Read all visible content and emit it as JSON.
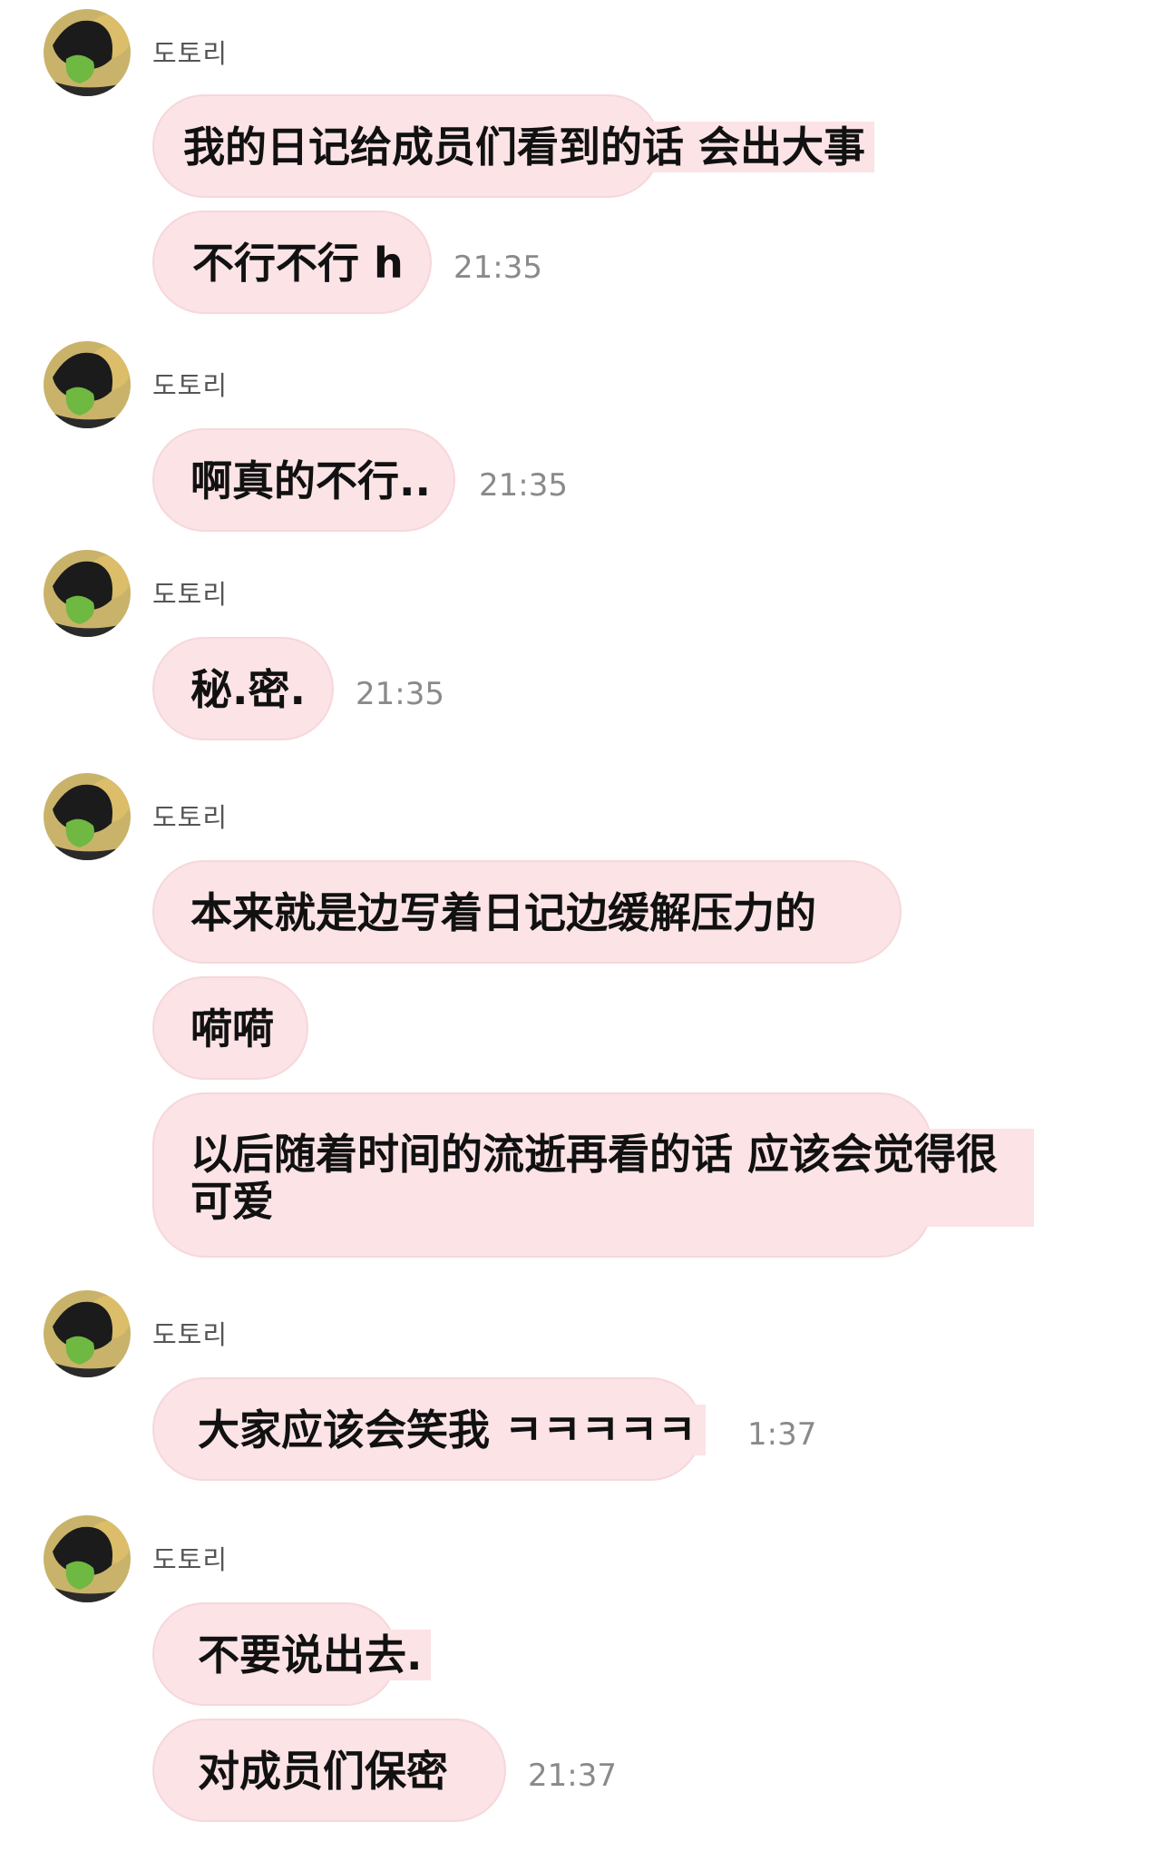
{
  "groups": [
    {
      "sender": "도토리",
      "messages": [
        {
          "text": "我的日记给成员们看到的话 会出大事"
        },
        {
          "text": "不行不行 h",
          "time": "21:35"
        }
      ]
    },
    {
      "sender": "도토리",
      "messages": [
        {
          "text": "啊真的不行..",
          "time": "21:35"
        }
      ]
    },
    {
      "sender": "도토리",
      "messages": [
        {
          "text": "秘.密.",
          "time": "21:35"
        }
      ]
    },
    {
      "sender": "도토리",
      "messages": [
        {
          "text": "本来就是边写着日记边缓解压力的"
        },
        {
          "text": "嗬嗬"
        },
        {
          "text": "以后随着时间的流逝再看的话 应该会觉得很可爱"
        }
      ]
    },
    {
      "sender": "도토리",
      "messages": [
        {
          "text": "大家应该会笑我 ㅋㅋㅋㅋㅋ",
          "time": "1:37"
        }
      ]
    },
    {
      "sender": "도토리",
      "messages": [
        {
          "text": "不要说出去."
        },
        {
          "text": "对成员们保密",
          "time": "21:37"
        }
      ]
    }
  ],
  "colors": {
    "bubble": "#fbe3e6",
    "bubble_border": "#f6d7dc",
    "time": "#8a8a8a",
    "sender": "#555555"
  },
  "icons": {
    "avatar": "profile-avatar-green-icon"
  }
}
